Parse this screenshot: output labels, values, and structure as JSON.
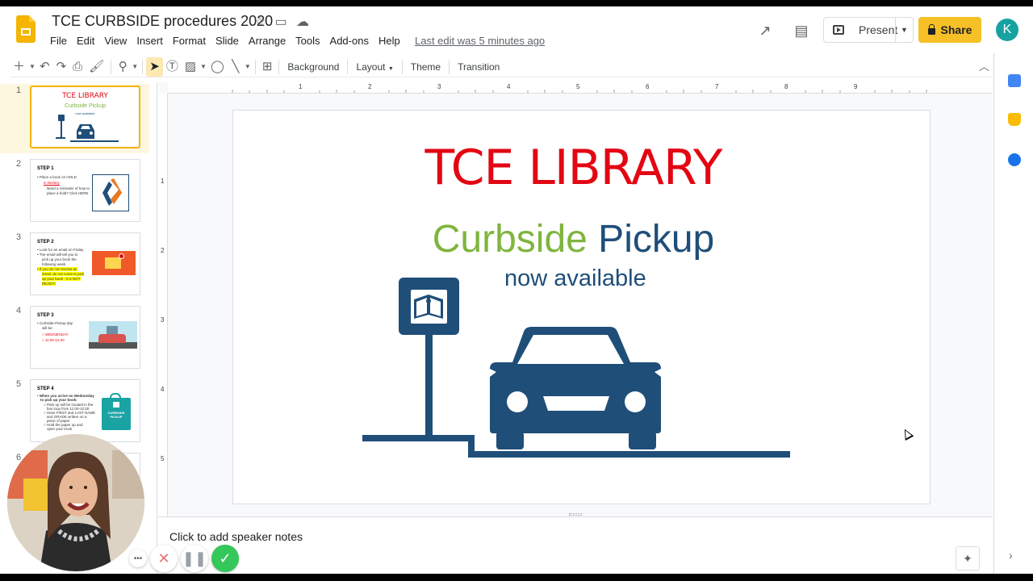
{
  "app": {
    "title": "TCE CURBSIDE procedures 2020",
    "menu": [
      "File",
      "Edit",
      "View",
      "Insert",
      "Format",
      "Slide",
      "Arrange",
      "Tools",
      "Add-ons",
      "Help"
    ],
    "last_edit": "Last edit was 5 minutes ago",
    "present_label": "Present",
    "share_label": "Share",
    "avatar_initial": "K"
  },
  "toolbar": {
    "background": "Background",
    "layout": "Layout",
    "theme": "Theme",
    "transition": "Transition"
  },
  "filmstrip": {
    "slides": [
      {
        "num": "1",
        "title": "TCE LIBRARY",
        "lines": [
          "Curbside Pickup",
          "now available"
        ]
      },
      {
        "num": "2",
        "title": "STEP 1",
        "lines": [
          "• Place a book on HOLD",
          "in Destiny",
          "Need a reminder of how to",
          "place a hold? Click HERE"
        ]
      },
      {
        "num": "3",
        "title": "STEP 2",
        "lines": [
          "• Look for an email on Friday",
          "• The email will tell you to",
          "pick up your book the",
          "following week",
          "• If you do not receive an",
          "email, do not come to pick",
          "up your book - it is NOT",
          "READY!"
        ]
      },
      {
        "num": "4",
        "title": "STEP 3",
        "lines": [
          "• Curbside Pickup day",
          "will be:",
          "○ WEDNESDAY",
          "○ 11:00-12:30"
        ]
      },
      {
        "num": "5",
        "title": "STEP 4",
        "lines": [
          "• When you arrive on Wednesday",
          "to pick up your book:",
          "○ Park up will be located in the",
          "bus loop from 11:00-12:30",
          "○ Have FIRST and LAST NAME",
          "and GRADE written on a",
          "piece of paper",
          "○ Hold the paper up and",
          "open your trunk"
        ],
        "badge": "CURBSIDE PICKUP"
      },
      {
        "num": "6",
        "title": "",
        "lines": []
      }
    ]
  },
  "slide": {
    "title": "TCE LIBRARY",
    "subtitle_green": "Curbside",
    "subtitle_blue": "Pickup",
    "tagline": "now available"
  },
  "ruler": {
    "h": [
      "1",
      "2",
      "3",
      "4",
      "5",
      "6",
      "7",
      "8",
      "9"
    ],
    "v": [
      "1",
      "2",
      "3",
      "4",
      "5"
    ]
  },
  "notes": {
    "placeholder": "Click to add speaker notes"
  },
  "colors": {
    "title_red": "#e30613",
    "green": "#7fb53e",
    "navy": "#1f4e79",
    "share_yellow": "#f6c026"
  }
}
